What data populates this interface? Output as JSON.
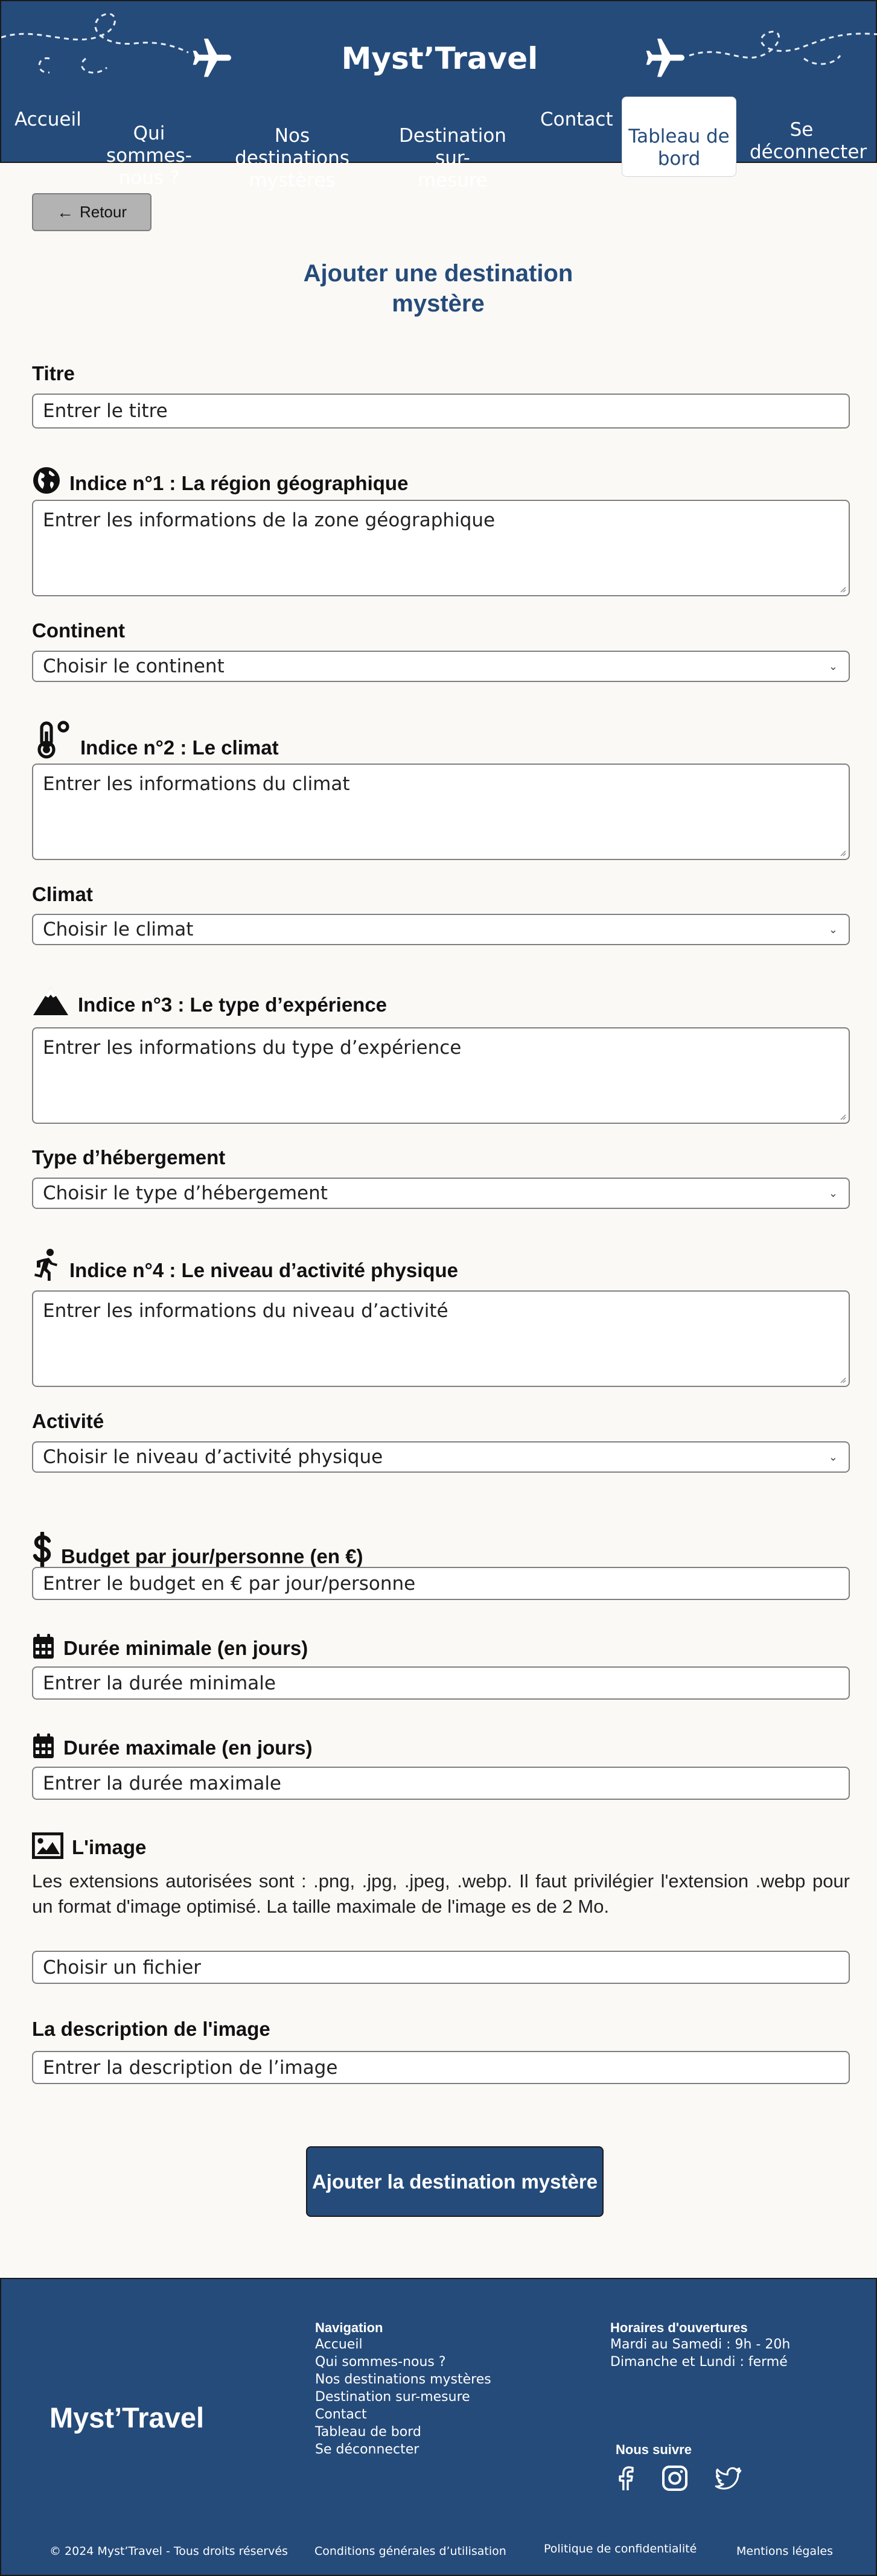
{
  "header": {
    "brand": "Myst’Travel",
    "nav": [
      {
        "label": "Accueil"
      },
      {
        "label": "Qui sommes-\nnous ?"
      },
      {
        "label": "Nos destinations\nmystères"
      },
      {
        "label": "Destination sur-\nmesure"
      },
      {
        "label": "Contact"
      },
      {
        "label": "Tableau de\nbord"
      },
      {
        "label": "Se\ndéconnecter"
      }
    ]
  },
  "form": {
    "back_label": "Retour",
    "title": "Ajouter une destination mystère",
    "titre_label": "Titre",
    "titre_placeholder": "Entrer le titre",
    "indice1_label": "Indice n°1 : La région géographique",
    "indice1_placeholder": "Entrer les informations de la zone géographique",
    "continent_label": "Continent",
    "continent_value": "Choisir le continent",
    "indice2_label": "Indice n°2 : Le climat",
    "indice2_placeholder": "Entrer les informations du climat",
    "climat_label": "Climat",
    "climat_value": "Choisir le climat",
    "indice3_label": "Indice n°3 : Le type d’expérience",
    "indice3_placeholder": "Entrer les informations du type d’expérience",
    "hebergement_label": "Type d’hébergement",
    "hebergement_value": "Choisir le type d’hébergement",
    "indice4_label": "Indice n°4 : Le niveau d’activité physique",
    "indice4_placeholder": "Entrer les informations du niveau d’activité",
    "activite_label": "Activité",
    "activite_value": "Choisir le niveau d’activité physique",
    "budget_label": "Budget par jour/personne (en €)",
    "budget_placeholder": "Entrer le budget en € par jour/personne",
    "duree_min_label": "Durée minimale (en jours)",
    "duree_min_placeholder": "Entrer la durée minimale",
    "duree_max_label": "Durée maximale (en jours)",
    "duree_max_placeholder": "Entrer la durée maximale",
    "image_label": "L'image",
    "image_help": "Les extensions autorisées sont : .png, .jpg, .jpeg, .webp. Il faut privilégier l'extension .webp pour un format d'image optimisé. La taille maximale de l'image es de 2 Mo.",
    "file_label": "Choisir un fichier",
    "image_desc_label": "La description de l'image",
    "image_desc_placeholder": "Entrer la description de l’image",
    "submit_label": "Ajouter la destination mystère"
  },
  "footer": {
    "brand": "Myst’Travel",
    "nav_heading": "Navigation",
    "nav_links": [
      "Accueil",
      "Qui sommes-nous ?",
      "Nos destinations mystères",
      "Destination sur-mesure",
      "Contact",
      "Tableau de bord",
      "Se déconnecter"
    ],
    "hours_heading": "Horaires d'ouvertures",
    "hours_1": "Mardi au Samedi : 9h - 20h",
    "hours_2": "Dimanche et Lundi : fermé",
    "follow_heading": "Nous suivre",
    "copyright": "© 2024 Myst’Travel - Tous droits réservés",
    "cgu": "Conditions générales d’utilisation",
    "privacy": "Politique de confidentialité",
    "legal": "Mentions légales"
  },
  "colors": {
    "primary": "#254b7a",
    "background": "#fbf9f6"
  },
  "icons": [
    "airplane-icon",
    "globe-icon",
    "thermometer-icon",
    "mountain-icon",
    "running-icon",
    "dollar-icon",
    "calendar-icon",
    "image-icon",
    "facebook-icon",
    "instagram-icon",
    "twitter-icon"
  ]
}
